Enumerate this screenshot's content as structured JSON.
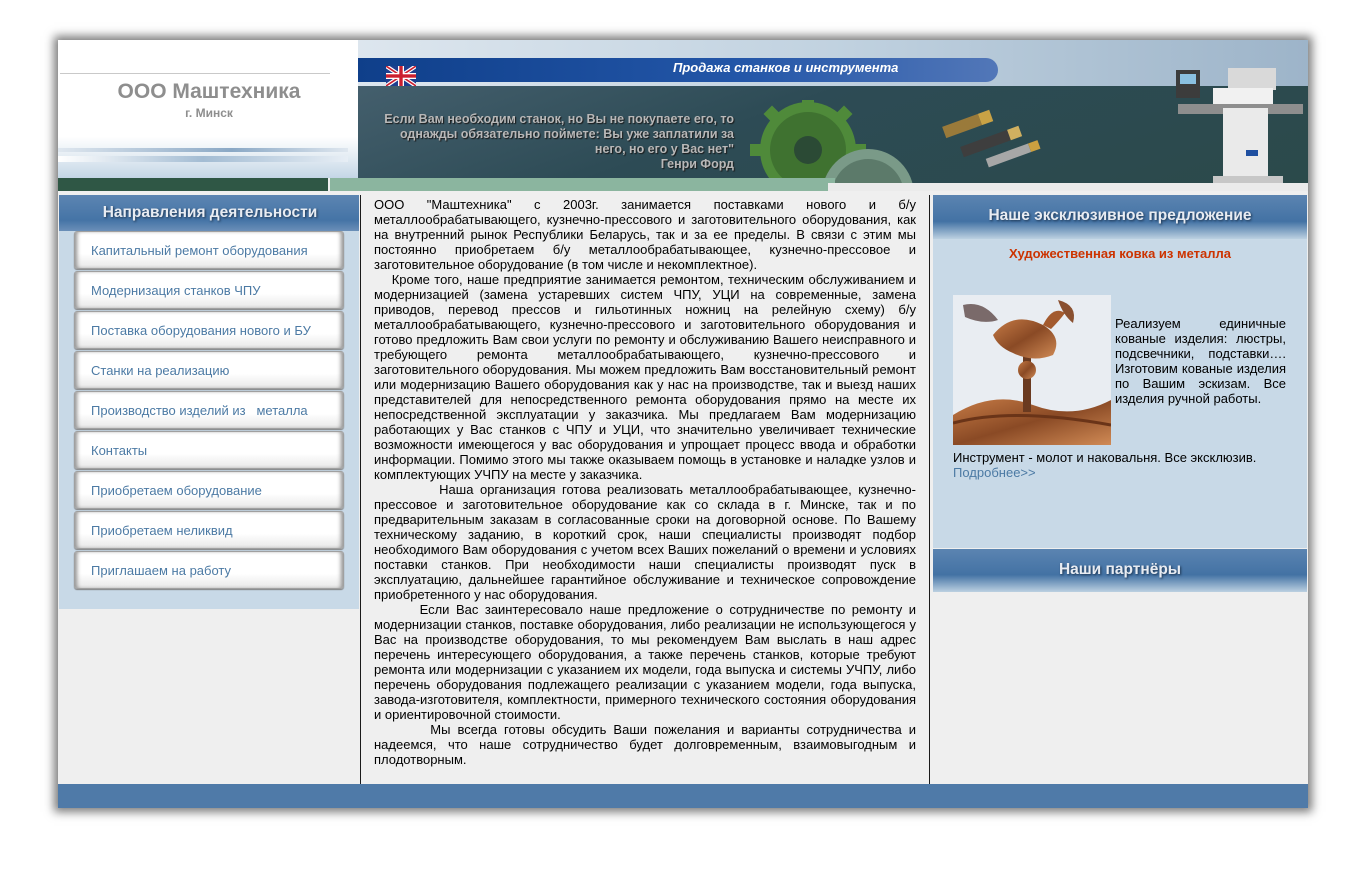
{
  "header": {
    "company_name": "ООО Маштехника",
    "company_city": "г. Минск",
    "tagline": "Продажа станков и инструмента",
    "quote_lines": [
      "Если Вам необходим станок, но Вы не покупаете его, то",
      "однажды обязательно поймете: Вы уже заплатили за",
      "него, но его у Вас нет\"",
      "Генри Форд"
    ],
    "language_flag": "uk-flag-icon"
  },
  "nav": {
    "title": "Направления деятельности",
    "items": [
      {
        "label": "Капитальный ремонт оборудования"
      },
      {
        "label": "Модернизация станков ЧПУ"
      },
      {
        "label": "Поставка оборудования нового и БУ"
      },
      {
        "label": "Станки на реализацию"
      },
      {
        "label": "Производство изделий из   металла"
      },
      {
        "label": "Контакты"
      },
      {
        "label": "Приобретаем оборудование"
      },
      {
        "label": "Приобретаем неликвид"
      },
      {
        "label": "Приглашаем на работу"
      }
    ]
  },
  "content": {
    "paragraphs": [
      "ООО \"Маштехника\" с 2003г. занимается поставками нового и б/у металлообрабатывающего, кузнечно-прессового и заготовительного оборудования, как на внутренний рынок Республики Беларусь, так и за ее пределы. В связи с этим мы постоянно приобретаем б/у металлообрабатывающее, кузнечно-прессовое и заготовительное оборудование (в том числе и некомплектное).",
      "    Кроме того, наше предприятие занимается ремонтом, техническим обслуживанием и модернизацией (замена устаревших систем ЧПУ, УЦИ на современные, замена приводов, перевод прессов и гильотинных ножниц на релейную схему) б/у металлообрабатывающего, кузнечно-прессового и заготовительного оборудования и готово предложить Вам свои услуги по ремонту и обслуживанию Вашего неисправного и требующего ремонта металлообрабатывающего, кузнечно-прессового и заготовительного оборудования. Мы можем предложить Вам восстановительный ремонт или модернизацию Вашего оборудования как у нас на производстве, так и выезд наших представителей для непосредственного ремонта оборудования прямо на месте их непосредственной эксплуатации у заказчика. Мы предлагаем Вам модернизацию работающих у Вас станков с ЧПУ и УЦИ, что значительно увеличивает технические возможности имеющегося у вас оборудования и упрощает процесс ввода и обработки информации. Помимо этого мы также оказываем помощь в установке и наладке узлов и комплектующих УЧПУ на месте у заказчика.",
      "          Наша организация готова реализовать металлообрабатывающее, кузнечно-прессовое и заготовительное оборудование как со склада в г. Минске, так и по предварительным заказам в согласованные сроки на договорной основе. По Вашему техническому заданию, в короткий срок, наши специалисты производят подбор необходимого Вам оборудования с учетом всех Ваших пожеланий о времени и условиях поставки станков. При необходимости наши специалисты производят пуск в эксплуатацию, дальнейшее гарантийное обслуживание и техническое сопровождение приобретенного у нас оборудования.",
      "       Если Вас заинтересовало наше предложение о сотрудничестве по ремонту и модернизации станков, поставке оборудования, либо реализации не использующегося у Вас на производстве оборудования, то мы рекомендуем Вам выслать в наш адрес перечень интересующего оборудования, а также перечень станков, которые требуют ремонта или модернизации с указанием их модели, года выпуска и системы УЧПУ, либо перечень оборудования подлежащего реализации с указанием модели, года выпуска, завода-изготовителя, комплектности, примерного технического состояния оборудования и ориентировочной стоимости.",
      "        Мы всегда готовы обсудить Ваши пожелания и варианты сотрудничества и надеемся, что наше сотрудничество будет долговременным, взаимовыгодным и плодотворным."
    ]
  },
  "offer": {
    "title": "Наше эксклюзивное предложение",
    "subtitle": "Художественная ковка из металла",
    "text_beside_image": "Реализуем единичные кованые изделия: люстры, подсвечники, подставки…. Изготовим кованые изделия по Вашим эскизам. Все изделия ручной работы.",
    "text_below_image": "Инструмент - молот и наковальня. Все эксклюзив.",
    "more_link": "Подробнее>>"
  },
  "partners": {
    "title": "Наши партнёры"
  },
  "colors": {
    "band_blue": "#4f7aa8",
    "panel_light_blue": "#c8d9e7",
    "link_blue": "#4c7aa4",
    "accent_red": "#cc3300"
  }
}
